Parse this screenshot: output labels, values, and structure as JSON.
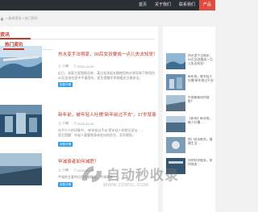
{
  "nav": {
    "items": [
      "首页",
      "关于我们",
      "联系我们",
      "产品"
    ]
  },
  "breadcrumb": {
    "text": "»  新闻资讯 » 热门资讯"
  },
  "main": {
    "section_title": "资讯"
  },
  "articles": [
    {
      "title": "热水变手法哦家，90后女孩要成一点儿失去知觉！杭州有多少人在用",
      "author": "小编",
      "date": "2023-10-20",
      "desc": "近日，浙医大医院报告称，某位女孩因长期使用热水袋导致下肢烫伤……",
      "desc2": "90后女孩在家中不慎烫伤，医生提醒冬季取暖应注意安全。",
      "btn": "查看详情"
    },
    {
      "title": "新年前，被年轻人吐槽“新年前过不去”，17岁就患了病，45岁开始",
      "author": "小编",
      "date": "2023-10-20",
      "desc": "在不少人的印象中，“新年前过不去”是年轻人的常见说法……",
      "desc2": "医生提醒：年轻人要重视身体发出的信号，及早就医。",
      "btn": "查看详情"
    },
    {
      "title": "甲减患者如何减肥？",
      "author": "小编",
      "date": "2023-10-20",
      "desc": "甲减的主要特点是代谢降低，甲减患者……",
      "desc2": "",
      "btn": "查看详情"
    }
  ],
  "sidebar": {
    "title": "热门资讯",
    "items": [
      "热水变手法哦家，90后女孩要成一点儿失去知觉！",
      "新年前，被年轻人吐槽“新年前过不去”",
      "甲减患者如何减肥？",
      "【新闻】新年前，被人吐槽……",
      "热门资讯推荐，健康生活……",
      "如何科学健身，保持体态……"
    ]
  },
  "watermark": {
    "brand": "自动秒收录",
    "sub": "WWW.ZDMSL.COM"
  },
  "colors": {
    "accent": "#c0392b",
    "nav_bg": "#2a2f35",
    "nav_active": "#e04b3f",
    "button": "#2f9be4"
  }
}
